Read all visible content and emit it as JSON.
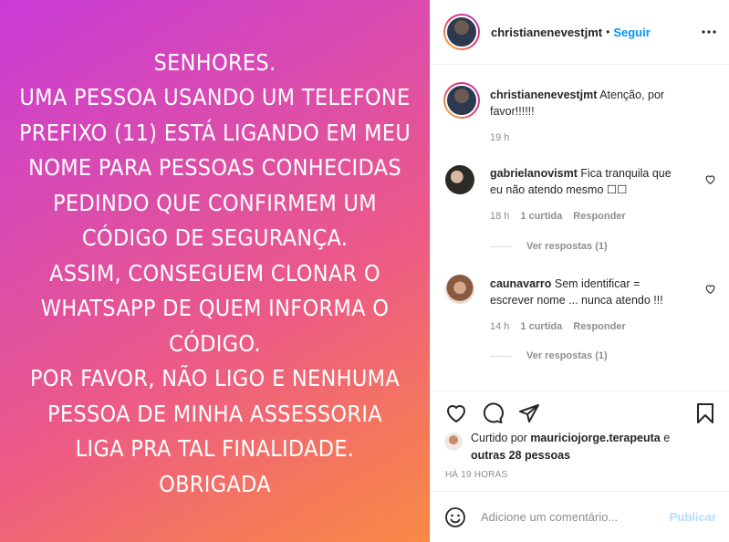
{
  "post": {
    "username": "christianenevestjmt",
    "separator": "•",
    "follow_label": "Seguir",
    "story_lines": [
      "SENHORES.",
      "UMA PESSOA USANDO UM TELEFONE",
      "PREFIXO (11) ESTÁ LIGANDO EM MEU",
      "NOME PARA PESSOAS CONHECIDAS",
      "PEDINDO QUE CONFIRMEM UM",
      "CÓDIGO DE SEGURANÇA.",
      "ASSIM, CONSEGUEM CLONAR O",
      "WHATSAPP DE QUEM INFORMA O",
      "CÓDIGO.",
      "POR FAVOR, NÃO LIGO E NENHUMA",
      "PESSOA DE MINHA ASSESSORIA",
      "LIGA PRA TAL FINALIDADE.",
      "OBRIGADA"
    ]
  },
  "caption": {
    "username": "christianenevestjmt",
    "text": " Atenção, por favor!!!!!!",
    "time": "19 h"
  },
  "comments": [
    {
      "username": "gabrielanovismt",
      "text": " Fica tranquila que eu não atendo mesmo ☐☐",
      "time": "18 h",
      "likes": "1 curtida",
      "reply_label": "Responder",
      "view_replies": "Ver respostas (1)"
    },
    {
      "username": "caunavarro",
      "text": " Sem identificar = escrever nome ... nunca atendo !!!",
      "time": "14 h",
      "likes": "1 curtida",
      "reply_label": "Responder",
      "view_replies": "Ver respostas (1)"
    }
  ],
  "likes": {
    "prefix": "Curtido por ",
    "user": "mauriciojorge.terapeuta",
    "middle": " e",
    "others": "outras 28 pessoas"
  },
  "timestamp": "HÁ 19 HORAS",
  "comment_box": {
    "placeholder": "Adicione um comentário...",
    "publish_label": "Publicar"
  },
  "colors": {
    "link_blue": "#0095f6",
    "publish_disabled": "#b2dffc",
    "muted": "#8e8e8e"
  },
  "icons": [
    "more-options-icon",
    "heart-icon",
    "comment-icon",
    "share-icon",
    "bookmark-icon",
    "emoji-icon"
  ]
}
